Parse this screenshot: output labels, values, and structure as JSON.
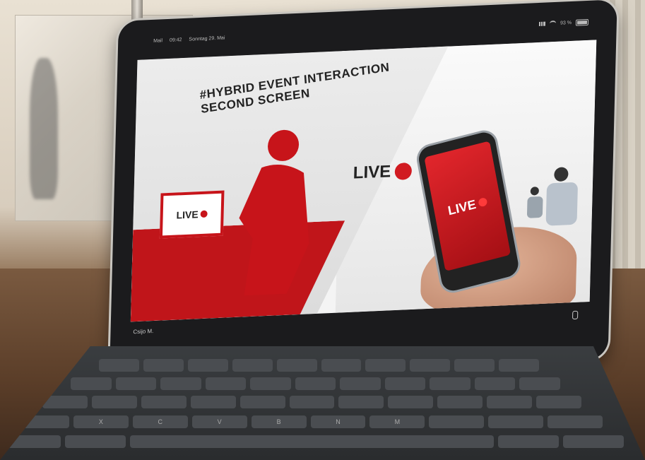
{
  "status": {
    "left_items": [
      "Mail",
      "09:42",
      "Sonntag 29. Mai"
    ],
    "battery": "93 %"
  },
  "slide": {
    "headline_1": "#HYBRID EVENT INTERACTION",
    "headline_2": "SECOND SCREEN",
    "live_laptop": "LIVE",
    "live_big": "LIVE",
    "live_phone": "LIVE",
    "accent_color": "#d11b21"
  },
  "participant": {
    "name": "Csijo M."
  },
  "keyboard": {
    "row1": [
      "",
      "",
      "",
      "",
      "",
      "",
      "",
      "",
      "",
      "",
      "",
      ""
    ],
    "row2": [
      "",
      "",
      "",
      "",
      "",
      "",
      "",
      "",
      "",
      "",
      ""
    ],
    "row3": [
      "",
      "",
      "",
      "",
      "",
      "",
      "",
      "",
      "",
      "",
      ""
    ],
    "row4": [
      "",
      "X",
      "C",
      "V",
      "B",
      "N",
      "M",
      "",
      "",
      "",
      ""
    ]
  }
}
